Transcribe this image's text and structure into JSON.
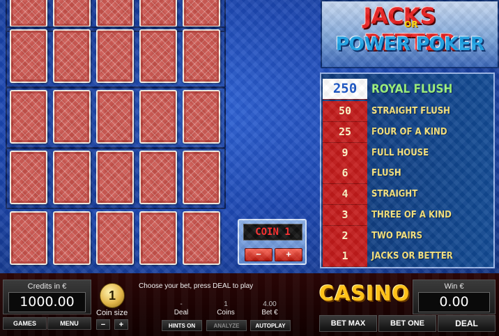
{
  "logo": {
    "line1": "JACKS",
    "or": "OR",
    "better": "BETTER",
    "line2": "POWER POKER"
  },
  "paytable": [
    {
      "value": "250",
      "name": "ROYAL FLUSH"
    },
    {
      "value": "50",
      "name": "STRAIGHT FLUSH"
    },
    {
      "value": "25",
      "name": "FOUR OF A KIND"
    },
    {
      "value": "9",
      "name": "FULL HOUSE"
    },
    {
      "value": "6",
      "name": "FLUSH"
    },
    {
      "value": "4",
      "name": "STRAIGHT"
    },
    {
      "value": "3",
      "name": "THREE OF A KIND"
    },
    {
      "value": "2",
      "name": "TWO PAIRS"
    },
    {
      "value": "1",
      "name": "JACKS OR BETTER"
    }
  ],
  "coin_box": {
    "display": "COIN 1",
    "minus": "−",
    "plus": "+"
  },
  "credits": {
    "label": "Credits in €",
    "value": "1000.00"
  },
  "games_label": "GAMES",
  "menu_label": "MENU",
  "coin_size": {
    "value": "1",
    "label": "Coin size",
    "minus": "−",
    "plus": "+"
  },
  "message": "Choose your bet, press DEAL to play",
  "stats": {
    "deal_value": "-",
    "deal_label": "Deal",
    "coins_value": "1",
    "coins_label": "Coins",
    "bet_value": "4.00",
    "bet_label": "Bet €"
  },
  "hints_label": "HINTS ON",
  "analyze_label": "ANALYZE",
  "autoplay_label": "AUTOPLAY",
  "casino_label": "CASINO",
  "win": {
    "label": "Win €",
    "value": "0.00"
  },
  "actions": {
    "bet_max": "BET MAX",
    "bet_one": "BET ONE",
    "deal": "DEAL"
  },
  "colors": {
    "card_back": "#c9524b",
    "paytable_red": "#c31b1b",
    "paytable_text": "#f6e27a",
    "casino_gold": "#ffc21a"
  }
}
